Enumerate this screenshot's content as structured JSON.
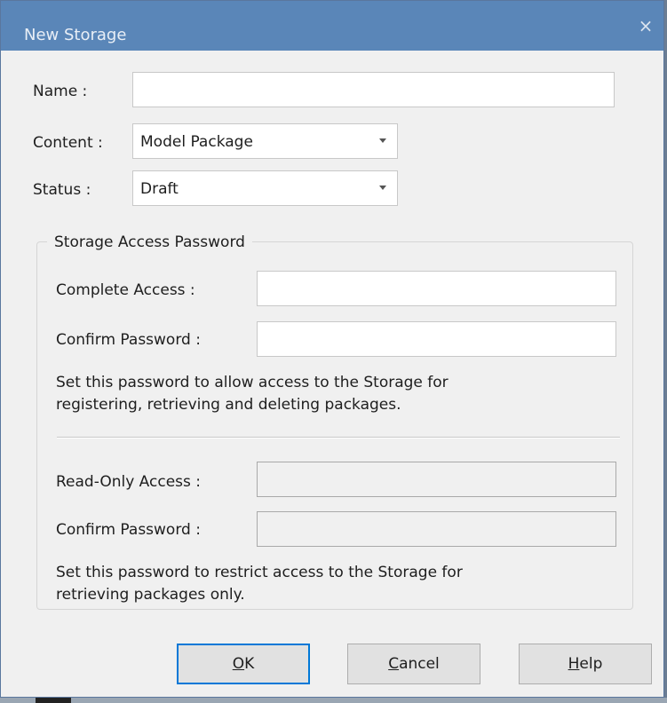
{
  "window": {
    "title": "New Storage",
    "close_glyph": "×"
  },
  "form": {
    "name_label": "Name :",
    "name_value": "",
    "content_label": "Content :",
    "content_value": "Model Package",
    "status_label": "Status :",
    "status_value": "Draft"
  },
  "password_group": {
    "title": "Storage Access Password",
    "complete_access_label": "Complete Access :",
    "complete_access_value": "",
    "confirm_label_1": "Confirm Password :",
    "confirm_value_1": "",
    "complete_hint_line1": "Set this password to allow access to the Storage for",
    "complete_hint_line2": "registering, retrieving and deleting packages.",
    "readonly_access_label": "Read-Only Access :",
    "readonly_access_value": "",
    "confirm_label_2": "Confirm Password :",
    "confirm_value_2": "",
    "readonly_hint_line1": "Set this password to restrict access to the Storage for",
    "readonly_hint_line2": "retrieving packages only."
  },
  "buttons": {
    "ok_access": "O",
    "ok_rest": "K",
    "cancel_access": "C",
    "cancel_rest": "ancel",
    "help_access": "H",
    "help_rest": "elp"
  },
  "icons": {
    "close": "close-icon",
    "dropdown": "chevron-down-icon"
  }
}
